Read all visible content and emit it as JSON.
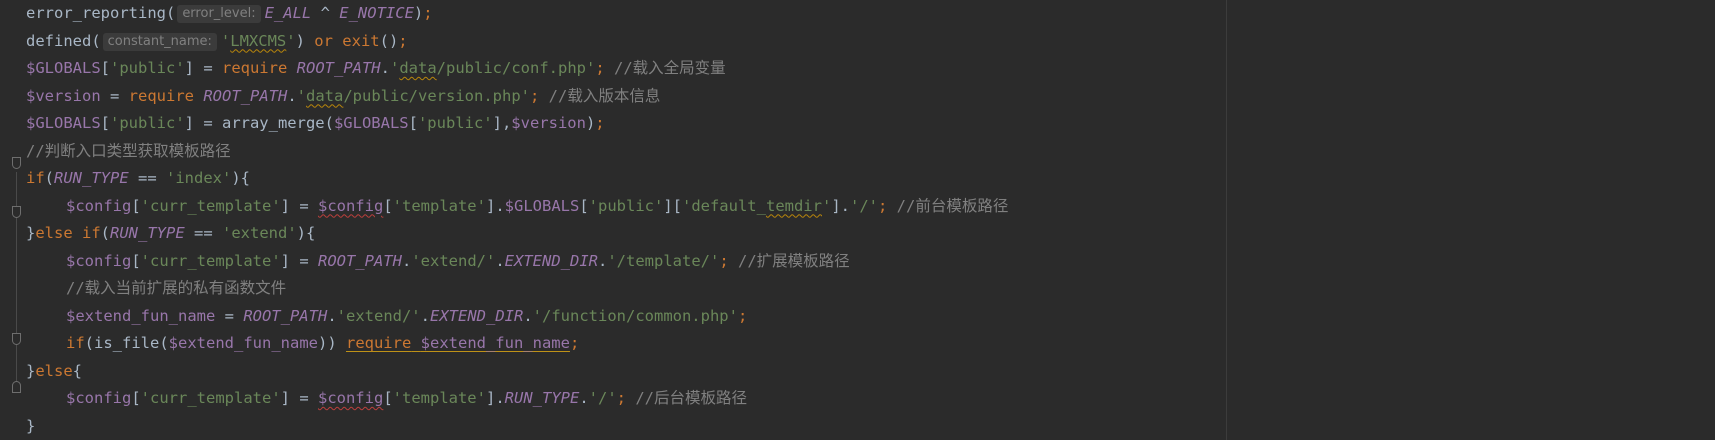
{
  "editor": {
    "language": "php",
    "theme_colors": {
      "background": "#2b2b2b",
      "keyword": "#cc7832",
      "constant": "#9876aa",
      "string": "#6a8759",
      "comment": "#808080",
      "default": "#a9b7c6"
    },
    "lines": [
      {
        "tokens": [
          {
            "t": "error_reporting(",
            "c": "fn"
          },
          {
            "t": "error_level:",
            "c": "hint"
          },
          {
            "t": "E_ALL",
            "c": "const"
          },
          {
            "t": " ^ ",
            "c": "punc"
          },
          {
            "t": "E_NOTICE",
            "c": "const"
          },
          {
            "t": ")",
            "c": "punc"
          },
          {
            "t": ";",
            "c": "semi"
          }
        ]
      },
      {
        "tokens": [
          {
            "t": "defined(",
            "c": "fn"
          },
          {
            "t": "constant_name:",
            "c": "hint"
          },
          {
            "t": "'",
            "c": "str"
          },
          {
            "t": "LMXCMS",
            "c": "str squig"
          },
          {
            "t": "'",
            "c": "str"
          },
          {
            "t": ") ",
            "c": "punc"
          },
          {
            "t": "or",
            "c": "kw"
          },
          {
            "t": " ",
            "c": "punc"
          },
          {
            "t": "exit",
            "c": "kw"
          },
          {
            "t": "()",
            "c": "punc"
          },
          {
            "t": ";",
            "c": "semi"
          }
        ]
      },
      {
        "tokens": [
          {
            "t": "$GLOBALS",
            "c": "var"
          },
          {
            "t": "[",
            "c": "punc"
          },
          {
            "t": "'public'",
            "c": "str"
          },
          {
            "t": "] = ",
            "c": "punc"
          },
          {
            "t": "require",
            "c": "kw"
          },
          {
            "t": " ",
            "c": "punc"
          },
          {
            "t": "ROOT_PATH",
            "c": "const"
          },
          {
            "t": ".",
            "c": "punc"
          },
          {
            "t": "'",
            "c": "str"
          },
          {
            "t": "data",
            "c": "str squig"
          },
          {
            "t": "/public/conf.php'",
            "c": "str"
          },
          {
            "t": ";",
            "c": "semi"
          },
          {
            "t": " //载入全局变量",
            "c": "cmt"
          }
        ]
      },
      {
        "tokens": [
          {
            "t": "$version",
            "c": "var"
          },
          {
            "t": " = ",
            "c": "punc"
          },
          {
            "t": "require",
            "c": "kw"
          },
          {
            "t": " ",
            "c": "punc"
          },
          {
            "t": "ROOT_PATH",
            "c": "const"
          },
          {
            "t": ".",
            "c": "punc"
          },
          {
            "t": "'",
            "c": "str"
          },
          {
            "t": "data",
            "c": "str squig"
          },
          {
            "t": "/public/version.php'",
            "c": "str"
          },
          {
            "t": ";",
            "c": "semi"
          },
          {
            "t": " //载入版本信息",
            "c": "cmt"
          }
        ]
      },
      {
        "tokens": [
          {
            "t": "$GLOBALS",
            "c": "var"
          },
          {
            "t": "[",
            "c": "punc"
          },
          {
            "t": "'public'",
            "c": "str"
          },
          {
            "t": "] = ",
            "c": "punc"
          },
          {
            "t": "array_merge(",
            "c": "fn"
          },
          {
            "t": "$GLOBALS",
            "c": "var"
          },
          {
            "t": "[",
            "c": "punc"
          },
          {
            "t": "'public'",
            "c": "str"
          },
          {
            "t": "],",
            "c": "punc"
          },
          {
            "t": "$version",
            "c": "var"
          },
          {
            "t": ")",
            "c": "punc"
          },
          {
            "t": ";",
            "c": "semi"
          }
        ]
      },
      {
        "tokens": [
          {
            "t": "//判断入口类型获取模板路径",
            "c": "cmt"
          }
        ]
      },
      {
        "tokens": [
          {
            "t": "if",
            "c": "kw"
          },
          {
            "t": "(",
            "c": "punc"
          },
          {
            "t": "RUN_TYPE",
            "c": "const"
          },
          {
            "t": " == ",
            "c": "punc"
          },
          {
            "t": "'index'",
            "c": "str"
          },
          {
            "t": "){",
            "c": "punc"
          }
        ]
      },
      {
        "indent": 1,
        "tokens": [
          {
            "t": "$config",
            "c": "var"
          },
          {
            "t": "[",
            "c": "punc"
          },
          {
            "t": "'curr_template'",
            "c": "str"
          },
          {
            "t": "] = ",
            "c": "punc"
          },
          {
            "t": "$config",
            "c": "var squig-red"
          },
          {
            "t": "[",
            "c": "punc"
          },
          {
            "t": "'template'",
            "c": "str"
          },
          {
            "t": "].",
            "c": "punc"
          },
          {
            "t": "$GLOBALS",
            "c": "var"
          },
          {
            "t": "[",
            "c": "punc"
          },
          {
            "t": "'public'",
            "c": "str"
          },
          {
            "t": "][",
            "c": "punc"
          },
          {
            "t": "'default_",
            "c": "str"
          },
          {
            "t": "temdir",
            "c": "str squig"
          },
          {
            "t": "'",
            "c": "str"
          },
          {
            "t": "].",
            "c": "punc"
          },
          {
            "t": "'/'",
            "c": "str"
          },
          {
            "t": ";",
            "c": "semi"
          },
          {
            "t": " //前台模板路径",
            "c": "cmt"
          }
        ]
      },
      {
        "tokens": [
          {
            "t": "}",
            "c": "punc"
          },
          {
            "t": "else if",
            "c": "kw"
          },
          {
            "t": "(",
            "c": "punc"
          },
          {
            "t": "RUN_TYPE",
            "c": "const"
          },
          {
            "t": " == ",
            "c": "punc"
          },
          {
            "t": "'extend'",
            "c": "str"
          },
          {
            "t": "){",
            "c": "punc"
          }
        ]
      },
      {
        "indent": 1,
        "tokens": [
          {
            "t": "$config",
            "c": "var"
          },
          {
            "t": "[",
            "c": "punc"
          },
          {
            "t": "'curr_template'",
            "c": "str"
          },
          {
            "t": "] = ",
            "c": "punc"
          },
          {
            "t": "ROOT_PATH",
            "c": "const"
          },
          {
            "t": ".",
            "c": "punc"
          },
          {
            "t": "'extend/'",
            "c": "str"
          },
          {
            "t": ".",
            "c": "punc"
          },
          {
            "t": "EXTEND_DIR",
            "c": "const"
          },
          {
            "t": ".",
            "c": "punc"
          },
          {
            "t": "'/template/'",
            "c": "str"
          },
          {
            "t": ";",
            "c": "semi"
          },
          {
            "t": " //扩展模板路径",
            "c": "cmt"
          }
        ]
      },
      {
        "indent": 1,
        "tokens": [
          {
            "t": "//载入当前扩展的私有函数文件",
            "c": "cmt"
          }
        ]
      },
      {
        "indent": 1,
        "tokens": [
          {
            "t": "$extend_fun_name",
            "c": "var"
          },
          {
            "t": " = ",
            "c": "punc"
          },
          {
            "t": "ROOT_PATH",
            "c": "const"
          },
          {
            "t": ".",
            "c": "punc"
          },
          {
            "t": "'extend/'",
            "c": "str"
          },
          {
            "t": ".",
            "c": "punc"
          },
          {
            "t": "EXTEND_DIR",
            "c": "const"
          },
          {
            "t": ".",
            "c": "punc"
          },
          {
            "t": "'/function/common.php'",
            "c": "str"
          },
          {
            "t": ";",
            "c": "semi"
          }
        ]
      },
      {
        "indent": 1,
        "tokens": [
          {
            "t": "if",
            "c": "kw"
          },
          {
            "t": "(",
            "c": "punc"
          },
          {
            "t": "is_file(",
            "c": "fn"
          },
          {
            "t": "$extend_fun_name",
            "c": "var"
          },
          {
            "t": ")) ",
            "c": "punc"
          },
          {
            "t": "require",
            "c": "kw warn-under"
          },
          {
            "t": " ",
            "c": "punc warn-under"
          },
          {
            "t": "$extend_fun_name",
            "c": "var warn-under"
          },
          {
            "t": ";",
            "c": "semi"
          }
        ]
      },
      {
        "tokens": [
          {
            "t": "}",
            "c": "punc"
          },
          {
            "t": "else",
            "c": "kw"
          },
          {
            "t": "{",
            "c": "punc"
          }
        ]
      },
      {
        "indent": 1,
        "tokens": [
          {
            "t": "$config",
            "c": "var"
          },
          {
            "t": "[",
            "c": "punc"
          },
          {
            "t": "'curr_template'",
            "c": "str"
          },
          {
            "t": "] = ",
            "c": "punc"
          },
          {
            "t": "$config",
            "c": "var squig-red"
          },
          {
            "t": "[",
            "c": "punc"
          },
          {
            "t": "'template'",
            "c": "str"
          },
          {
            "t": "].",
            "c": "punc"
          },
          {
            "t": "RUN_TYPE",
            "c": "const"
          },
          {
            "t": ".",
            "c": "punc"
          },
          {
            "t": "'/'",
            "c": "str"
          },
          {
            "t": ";",
            "c": "semi"
          },
          {
            "t": " //后台模板路径",
            "c": "cmt"
          }
        ]
      },
      {
        "tokens": [
          {
            "t": "}",
            "c": "punc"
          }
        ]
      }
    ]
  }
}
